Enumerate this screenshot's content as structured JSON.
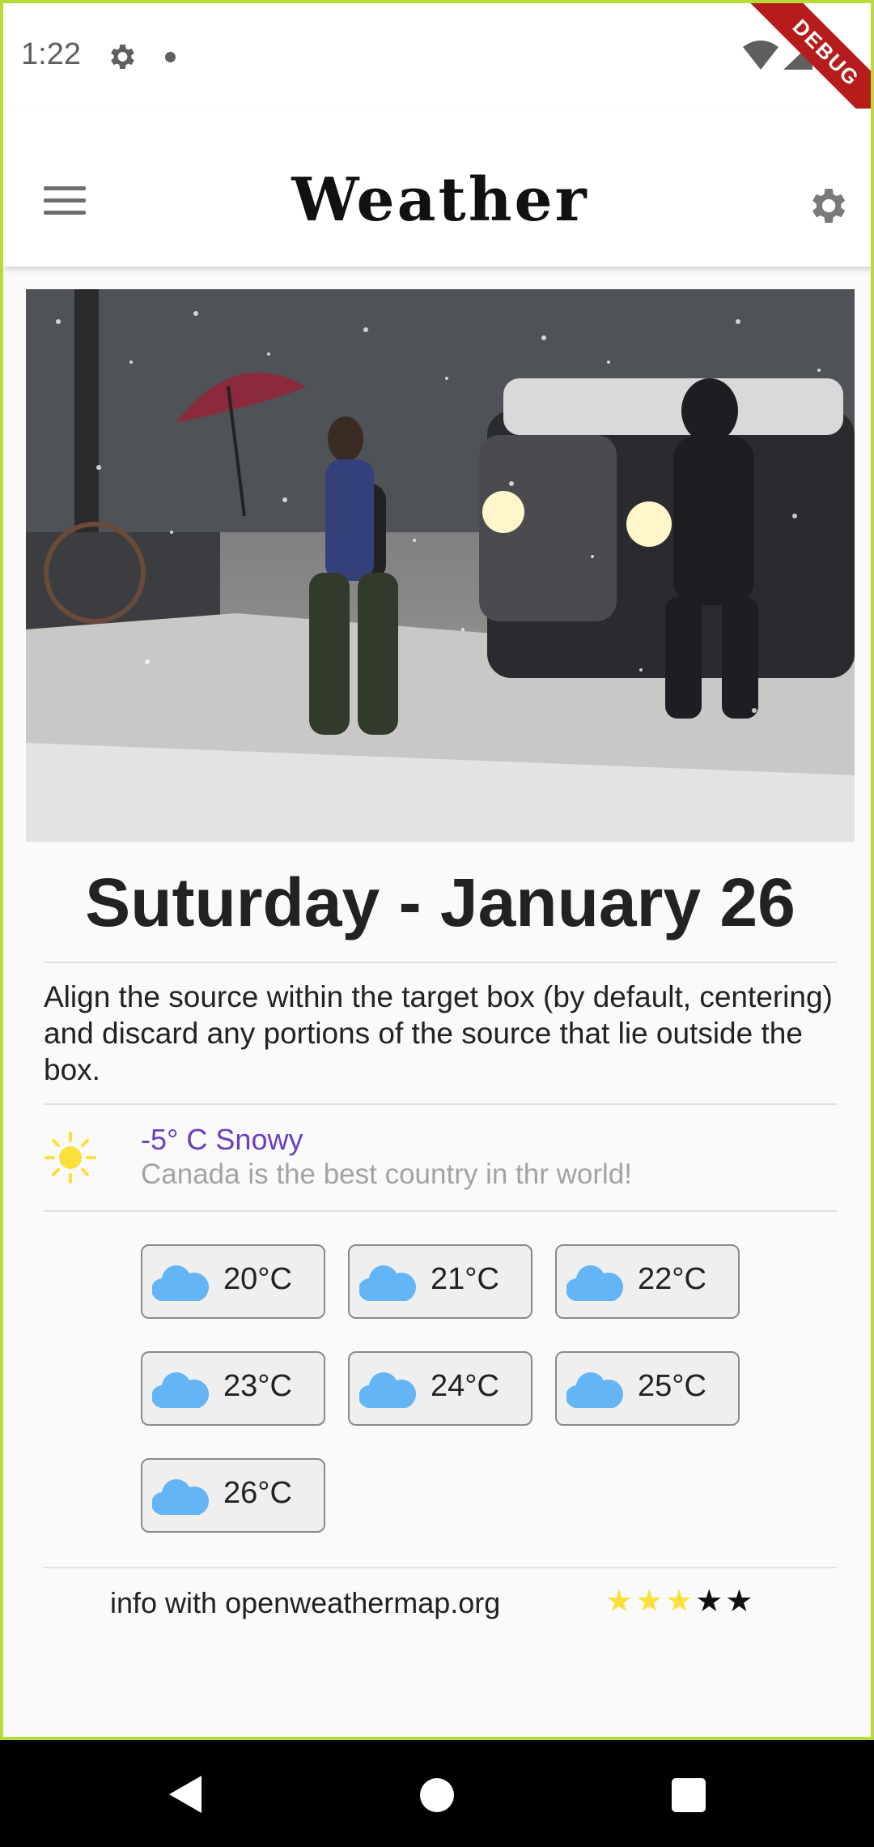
{
  "status_bar": {
    "time": "1:22",
    "debug_label": "DEBUG",
    "icons": [
      "settings-icon",
      "notification-dot-icon",
      "wifi-icon",
      "signal-icon",
      "battery-icon"
    ]
  },
  "app_bar": {
    "title": "Weather",
    "menu_icon": "menu-icon",
    "settings_icon": "gear-icon"
  },
  "hero": {
    "image": "snowy-street-photo"
  },
  "date_heading": "Suturday - January 26",
  "description": "Align the source within the target box (by default, centering) and discard any portions of the source that lie outside the box.",
  "weather": {
    "icon": "sun-icon",
    "temperature": "-5° C Snowy",
    "subtitle": "Canada is the best country in thr world!"
  },
  "forecast_chips": [
    {
      "label": "20°C",
      "icon": "cloud-icon"
    },
    {
      "label": "21°C",
      "icon": "cloud-icon"
    },
    {
      "label": "22°C",
      "icon": "cloud-icon"
    },
    {
      "label": "23°C",
      "icon": "cloud-icon"
    },
    {
      "label": "24°C",
      "icon": "cloud-icon"
    },
    {
      "label": "25°C",
      "icon": "cloud-icon"
    },
    {
      "label": "26°C",
      "icon": "cloud-icon"
    }
  ],
  "footer": {
    "source_text": "info with openweathermap.org",
    "rating": 3,
    "rating_max": 5
  },
  "colors": {
    "accent": "#6a3fbf",
    "sun": "#fbe03c",
    "cloud": "#64b5f6",
    "frame_border": "#b7dc3a",
    "debug_ribbon": "#b71c1c"
  },
  "nav_bar": {
    "icons": [
      "back-icon",
      "home-icon",
      "recents-icon"
    ]
  }
}
